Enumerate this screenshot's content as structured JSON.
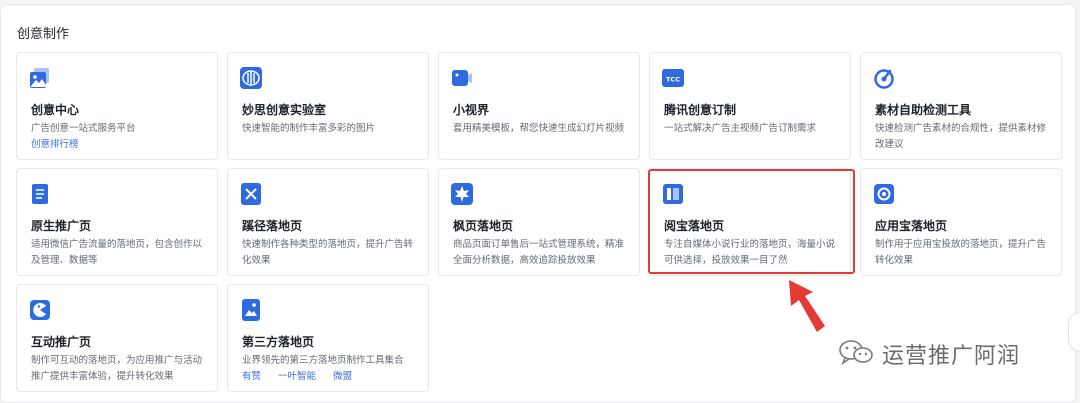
{
  "section_title": "创意制作",
  "cards": [
    {
      "title": "创意中心",
      "desc": "广告创意一站式服务平台",
      "links": [
        "创意排行榜"
      ],
      "icon": "image-gallery-icon"
    },
    {
      "title": "妙思创意实验室",
      "desc": "快速智能的制作丰富多彩的图片",
      "icon": "waveform-icon"
    },
    {
      "title": "小视界",
      "desc": "套用精美模板，帮您快速生成幻灯片视频",
      "icon": "video-camera-icon"
    },
    {
      "title": "腾讯创意订制",
      "desc": "一站式解决广告主视频广告订制需求",
      "icon": "tcc-badge-icon"
    },
    {
      "title": "素材自助检测工具",
      "desc": "快速检测广告素材的合规性，提供素材修改建议",
      "icon": "gauge-icon"
    },
    {
      "title": "原生推广页",
      "desc": "适用微信广告流量的落地页，包含创作以及管理、数据等",
      "icon": "document-icon"
    },
    {
      "title": "蹊径落地页",
      "desc": "快速制作各种类型的落地页，提升广告转化效果",
      "icon": "crossed-tools-icon"
    },
    {
      "title": "枫页落地页",
      "desc": "商品页面订单售后一站式管理系统，精准全面分析数据，高效追踪投放效果",
      "icon": "maple-leaf-icon"
    },
    {
      "title": "阅宝落地页",
      "desc": "专注自媒体小说行业的落地页，海量小说可供选择，投放效果一目了然",
      "icon": "book-icon"
    },
    {
      "title": "应用宝落地页",
      "desc": "制作用于应用宝投放的落地页，提升广告转化效果",
      "icon": "app-store-icon"
    },
    {
      "title": "互动推广页",
      "desc": "制作可互动的落地页，为应用推广与活动推广提供丰富体验，提升转化效果",
      "icon": "pacman-icon"
    },
    {
      "title": "第三方落地页",
      "desc": "业界领先的第三方落地页制作工具集合",
      "links": [
        "有赞",
        "一叶智能",
        "微盟"
      ],
      "icon": "landscape-page-icon"
    }
  ],
  "watermark": "运营推广阿润",
  "colors": {
    "accent": "#3b6fe0",
    "icon": "#2f6bdf",
    "highlight": "#e53935"
  }
}
